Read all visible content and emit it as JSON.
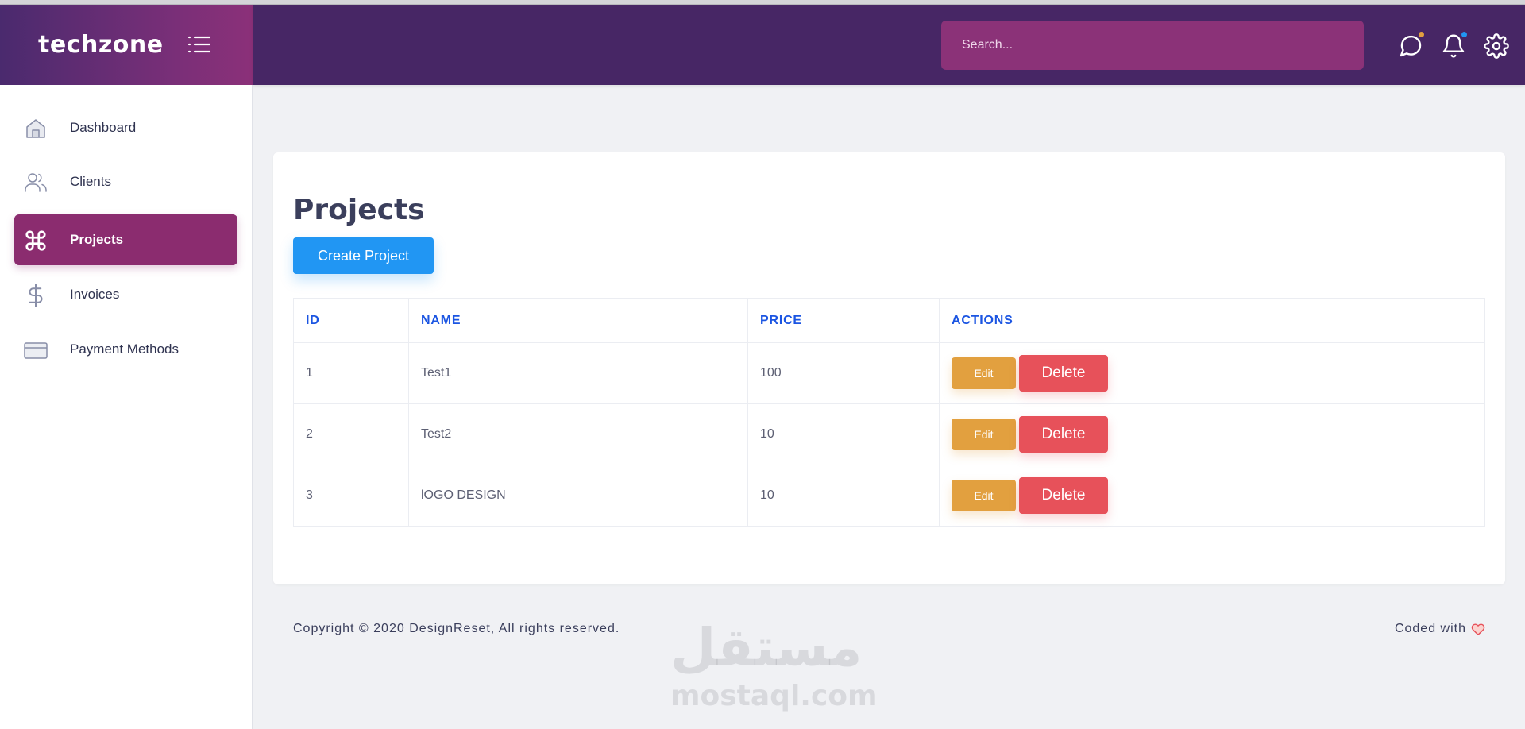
{
  "brand": {
    "logo": "techzone"
  },
  "header": {
    "search_placeholder": "Search...",
    "icons": [
      "menu-list-icon",
      "chat-icon",
      "bell-icon",
      "gear-icon"
    ],
    "notification_dot_colors": [
      "#e2a03f",
      "#2196f3"
    ]
  },
  "sidebar": {
    "items": [
      {
        "label": "Dashboard",
        "icon": "home-icon",
        "active": false
      },
      {
        "label": "Clients",
        "icon": "users-icon",
        "active": false
      },
      {
        "label": "Projects",
        "icon": "command-icon",
        "active": true
      },
      {
        "label": "Invoices",
        "icon": "dollar-icon",
        "active": false
      },
      {
        "label": "Payment Methods",
        "icon": "credit-card-icon",
        "active": false
      }
    ]
  },
  "main": {
    "title": "Projects",
    "create_button": "Create Project",
    "table": {
      "headers": [
        "ID",
        "NAME",
        "PRICE",
        "ACTIONS"
      ],
      "rows": [
        {
          "id": "1",
          "name": "Test1",
          "price": "100"
        },
        {
          "id": "2",
          "name": "Test2",
          "price": "10"
        },
        {
          "id": "3",
          "name": "lOGO DESIGN",
          "price": "10"
        }
      ],
      "edit_label": "Edit",
      "delete_label": "Delete"
    }
  },
  "footer": {
    "copyright": "Copyright © 2020 DesignReset, All rights reserved.",
    "coded_with": "Coded with"
  },
  "watermark": {
    "arabic": "مستقل",
    "latin": "mostaql.com"
  },
  "colors": {
    "header_bg": "#472665",
    "search_bg": "#8b3278",
    "active_nav": "#8b2c6f",
    "primary": "#2196f3",
    "warning": "#e2a03f",
    "danger": "#e7515a",
    "table_header": "#1b55e2"
  }
}
